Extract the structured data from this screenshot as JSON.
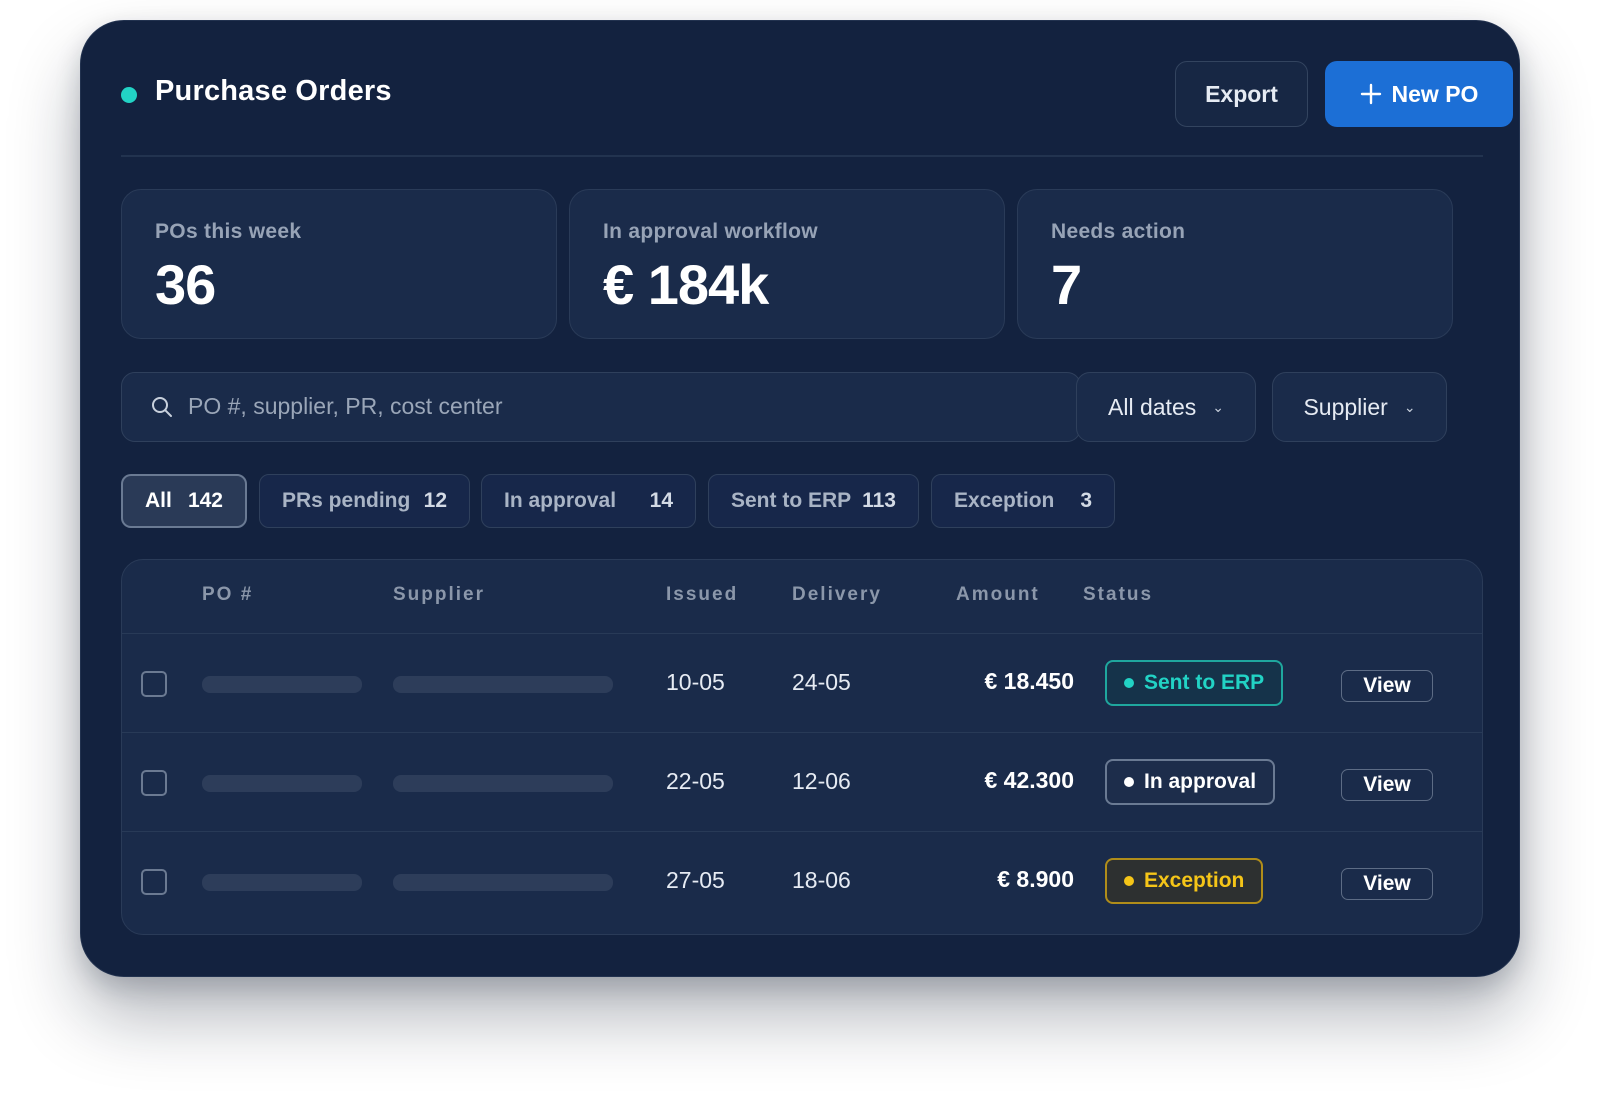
{
  "header": {
    "title": "Purchase Orders",
    "export_label": "Export",
    "new_label": "New PO"
  },
  "stats": [
    {
      "label": "POs this week",
      "value": "36"
    },
    {
      "label": "In approval workflow",
      "value": "€ 184k"
    },
    {
      "label": "Needs action",
      "value": "7"
    }
  ],
  "search": {
    "placeholder": "PO #, supplier, PR, cost center",
    "value": ""
  },
  "filters": {
    "dates": "All dates",
    "supplier": "Supplier"
  },
  "chips": [
    {
      "label": "All",
      "count": "142",
      "active": true
    },
    {
      "label": "PRs pending",
      "count": "12"
    },
    {
      "label": "In approval",
      "count": "14"
    },
    {
      "label": "Sent to ERP",
      "count": "113"
    },
    {
      "label": "Exception",
      "count": "3"
    }
  ],
  "table": {
    "columns": [
      "PO #",
      "Supplier",
      "Issued",
      "Delivery",
      "Amount",
      "Status"
    ],
    "rows": [
      {
        "issued": "10-05",
        "delivery": "24-05",
        "amount": "€ 18.450",
        "status": "Sent to ERP",
        "action": "View"
      },
      {
        "issued": "22-05",
        "delivery": "12-06",
        "amount": "€ 42.300",
        "status": "In approval",
        "action": "View"
      },
      {
        "issued": "27-05",
        "delivery": "18-06",
        "amount": "€ 8.900",
        "status": "Exception",
        "action": "View"
      }
    ]
  },
  "colors": {
    "background": "#13223f",
    "accent": "#22d3c5",
    "primary": "#1c6fd6",
    "status_sent": "#22d3c5",
    "status_approval": "#ffffff",
    "status_exception": "#f5c518"
  }
}
